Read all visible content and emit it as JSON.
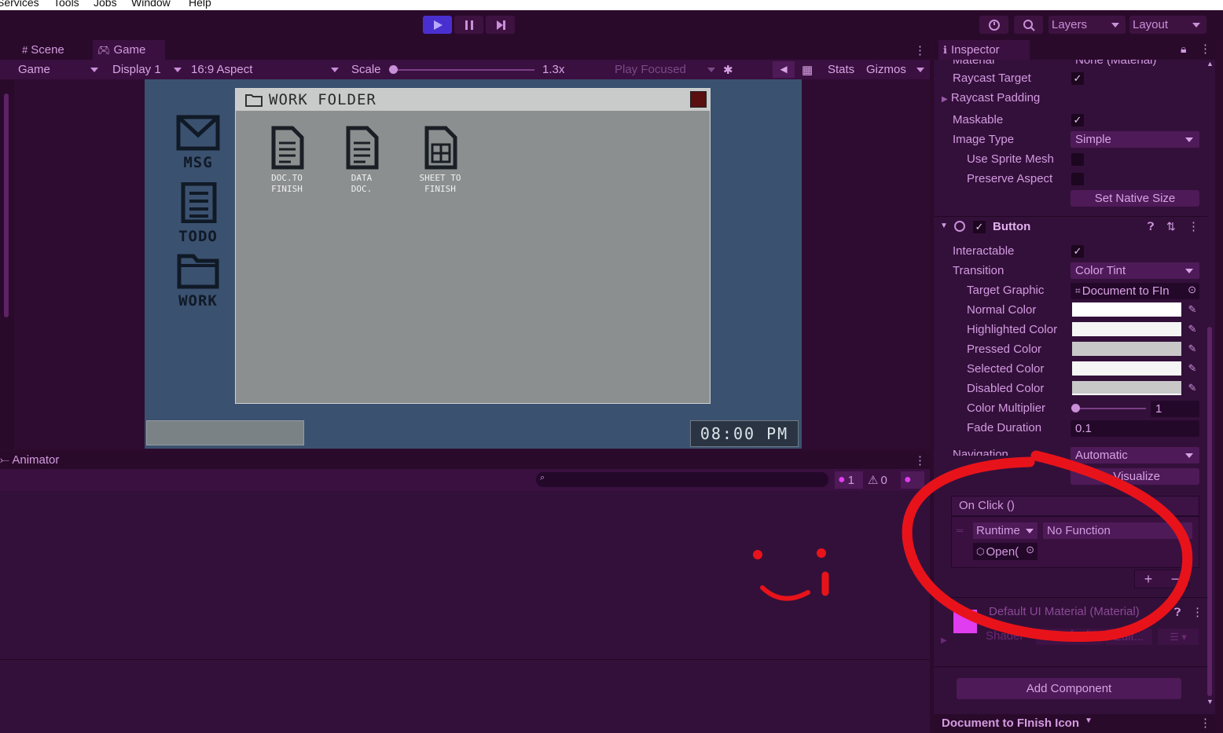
{
  "menu": {
    "items": [
      "Services",
      "Tools",
      "Jobs",
      "Window",
      "Help"
    ]
  },
  "toolbar": {
    "layers_label": "Layers",
    "layout_label": "Layout"
  },
  "tabs": {
    "scene": "Scene",
    "game": "Game"
  },
  "gamebar": {
    "mode": "Game",
    "display": "Display 1",
    "aspect": "16:9 Aspect",
    "scale_label": "Scale",
    "scale_value": "1.3x",
    "play_focused": "Play Focused",
    "stats": "Stats",
    "gizmos": "Gizmos"
  },
  "game": {
    "window_title": "WORK FOLDER",
    "desktop_icons": [
      "MSG",
      "TODO",
      "WORK"
    ],
    "files": [
      {
        "line1": "DOC.TO",
        "line2": "FINISH"
      },
      {
        "line1": "DATA",
        "line2": "DOC."
      },
      {
        "line1": "SHEET TO",
        "line2": "FINISH"
      }
    ],
    "clock": "08:00 PM"
  },
  "animator": {
    "title": "Animator",
    "error_count": "1",
    "warning_count": "0"
  },
  "inspector": {
    "title": "Inspector",
    "material_label": "Material",
    "material_value": "None (Material)",
    "raycast_target": "Raycast Target",
    "raycast_padding": "Raycast Padding",
    "maskable": "Maskable",
    "image_type_label": "Image Type",
    "image_type_value": "Simple",
    "use_sprite_mesh": "Use Sprite Mesh",
    "preserve_aspect": "Preserve Aspect",
    "set_native_size": "Set Native Size",
    "button_component": "Button",
    "interactable": "Interactable",
    "transition_label": "Transition",
    "transition_value": "Color Tint",
    "target_graphic_label": "Target Graphic",
    "target_graphic_value": "Document to FIn",
    "normal_color": "Normal Color",
    "highlighted_color": "Highlighted Color",
    "pressed_color": "Pressed Color",
    "selected_color": "Selected Color",
    "disabled_color": "Disabled Color",
    "color_multiplier_label": "Color Multiplier",
    "color_multiplier_value": "1",
    "fade_duration_label": "Fade Duration",
    "fade_duration_value": "0.1",
    "navigation_label": "Navigation",
    "navigation_value": "Automatic",
    "visualize": "Visualize",
    "on_click": "On Click ()",
    "runtime": "Runtime",
    "no_function": "No Function",
    "open_object": "Open(",
    "material_name": "Default UI Material (Material)",
    "shader_label": "Shader",
    "shader_value": "UI/Default",
    "edit_label": "Edit...",
    "add_component": "Add Component",
    "footer_object": "Document to FInish Icon"
  },
  "colors": {
    "accent": "#e03cf0",
    "annotation": "#e8131a",
    "play_active": "#4a2fd0"
  }
}
